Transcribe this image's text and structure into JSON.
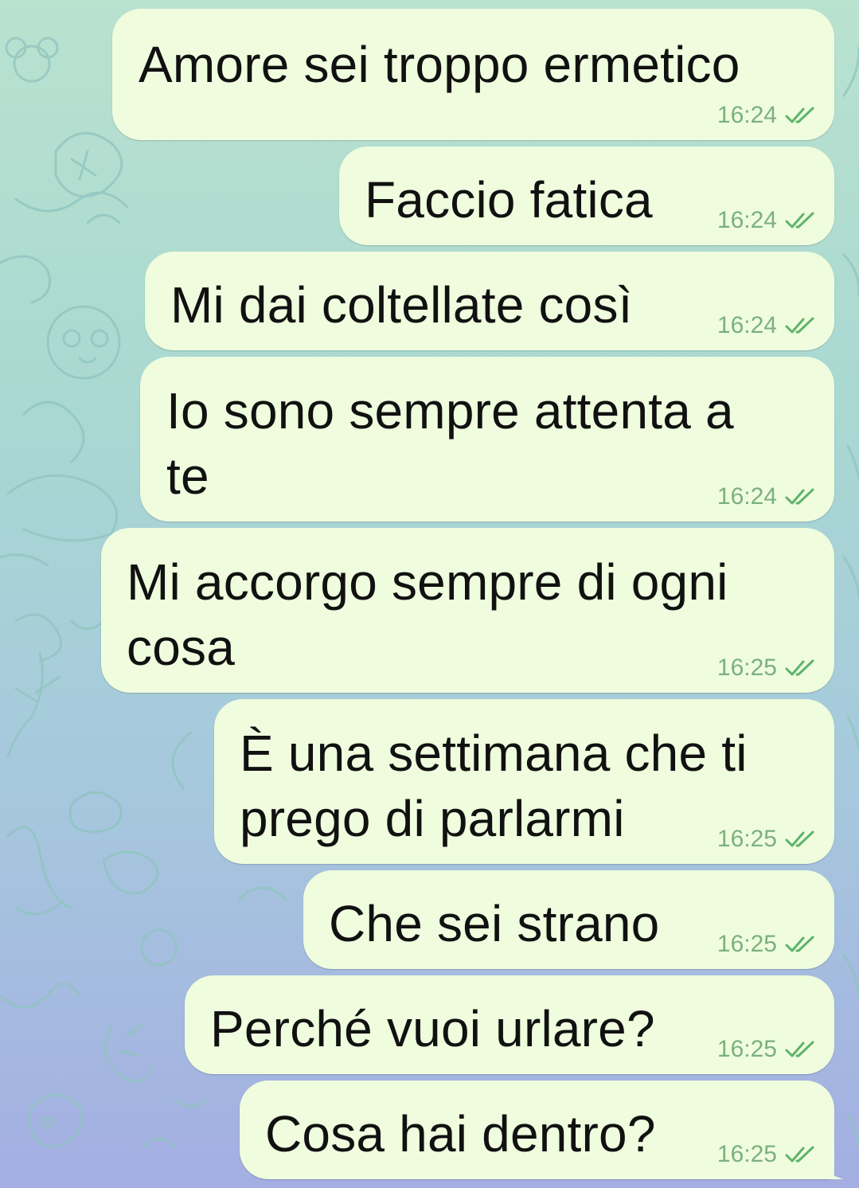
{
  "chat": {
    "messages": [
      {
        "text": "Amore sei troppo ermetico",
        "time": "16:24",
        "status": "read-double-check"
      },
      {
        "text": "Faccio fatica",
        "time": "16:24",
        "status": "read-double-check"
      },
      {
        "text": "Mi dai coltellate così",
        "time": "16:24",
        "status": "read-double-check"
      },
      {
        "text": "Io sono sempre attenta a\nte",
        "time": "16:24",
        "status": "read-double-check"
      },
      {
        "text": "Mi accorgo sempre di ogni\ncosa",
        "time": "16:25",
        "status": "read-double-check"
      },
      {
        "text": "È una settimana che ti\nprego di parlarmi",
        "time": "16:25",
        "status": "read-double-check"
      },
      {
        "text": "Che sei strano",
        "time": "16:25",
        "status": "read-double-check"
      },
      {
        "text": "Perché vuoi urlare?",
        "time": "16:25",
        "status": "read-double-check"
      },
      {
        "text": "Cosa hai dentro?",
        "time": "16:25",
        "status": "read-double-check"
      }
    ]
  },
  "colors": {
    "outgoing_bubble": "#effdde",
    "text": "#111111",
    "time": "#7bb07f",
    "check": "#5fb36b",
    "wallpaper_top": "#b9e2cf",
    "wallpaper_bottom": "#a4aee2"
  }
}
